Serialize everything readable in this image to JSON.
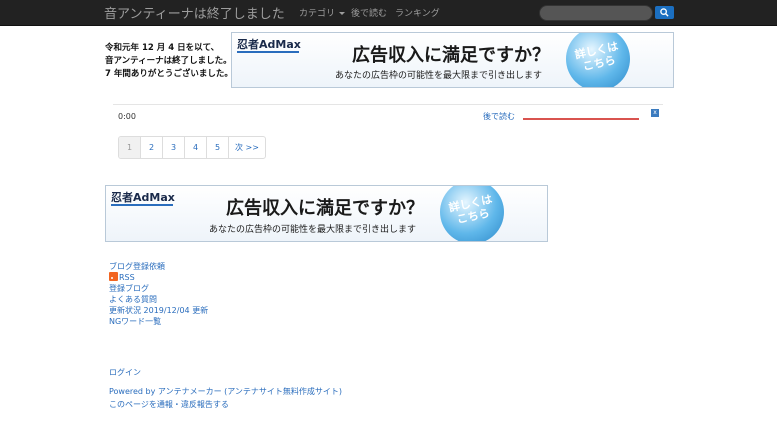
{
  "navbar": {
    "brand": "音アンティーナは終了しました",
    "items": [
      "カテゴリ",
      "後で読む",
      "ランキング"
    ]
  },
  "notice": [
    "令和元年 12 月 4 日を以て、",
    "音アンティーナは終了しました。",
    "7 年間ありがとうございました。"
  ],
  "ad": {
    "logo": "忍者AdMax",
    "headline": "広告収入に満足ですか？",
    "subline": "あなたの広告枠の可能性を最大限まで引き出します",
    "cta": [
      "詳しくは",
      "こちら"
    ]
  },
  "player": {
    "time": "0:00",
    "read_later": "後で読む",
    "close": "x"
  },
  "pagination": [
    "1",
    "2",
    "3",
    "4",
    "5",
    "次 >>"
  ],
  "footer": {
    "links": [
      "ブログ登録依頼",
      "RSS",
      "登録ブログ",
      "よくある質問",
      "更新状況 2019/12/04 更新",
      "NGワード一覧"
    ],
    "login": "ログイン",
    "powered": "Powered by アンテナメーカー (アンテナサイト無料作成サイト)",
    "report": "このページを通報・違反報告する"
  },
  "colors": {
    "navbar": "#222222",
    "link": "#2a6dbd",
    "accent": "#1b6fc1",
    "progress": "#d9534f"
  }
}
